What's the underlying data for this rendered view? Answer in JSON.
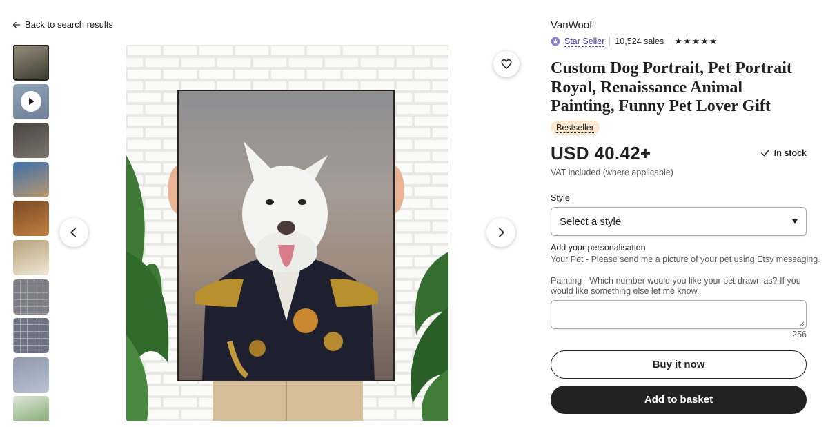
{
  "nav": {
    "back_label": "Back to search results"
  },
  "gallery": {
    "thumbnails": [
      {
        "kind": "portrait",
        "colors": [
          "#9a8f80",
          "#3a3a2e"
        ]
      },
      {
        "kind": "video",
        "colors": [
          "#8ea2b8",
          "#6d7f96"
        ]
      },
      {
        "kind": "photo",
        "colors": [
          "#4a4440",
          "#7b746c"
        ]
      },
      {
        "kind": "photo",
        "colors": [
          "#3f6fa8",
          "#b89870"
        ]
      },
      {
        "kind": "photo",
        "colors": [
          "#7a4a26",
          "#c08040"
        ]
      },
      {
        "kind": "photo",
        "colors": [
          "#b7a27a",
          "#efe7d6"
        ]
      },
      {
        "kind": "grid",
        "colors": [
          "#7e7e86",
          "#a4a0a6"
        ]
      },
      {
        "kind": "grid",
        "colors": [
          "#6e7382",
          "#a3a7b4"
        ]
      },
      {
        "kind": "photo",
        "colors": [
          "#8f99ad",
          "#b9c1d1"
        ]
      },
      {
        "kind": "photo",
        "colors": [
          "#dfe6d9",
          "#6fa05e"
        ]
      }
    ],
    "main_image": {
      "subject": "dog-portrait-royal"
    }
  },
  "product": {
    "shop_name": "VanWoof",
    "star_seller_label": "Star Seller",
    "sales": "10,524 sales",
    "rating_stars": "★★★★★",
    "title": "Custom Dog Portrait, Pet Portrait Royal, Renaissance Animal Painting, Funny Pet Lover Gift",
    "badge": "Bestseller",
    "price": "USD 40.42+",
    "stock": "In stock",
    "vat_note": "VAT included (where applicable)"
  },
  "options": {
    "style_label": "Style",
    "style_selected": "Select a style"
  },
  "personalisation": {
    "title": "Add your personalisation",
    "line1": "Your Pet - Please send me a picture of your pet using Etsy messaging.",
    "line2": "Painting - Which number would you like your pet drawn as? If you would like something else let me know.",
    "value": "",
    "char_count": "256"
  },
  "actions": {
    "buy_now": "Buy it now",
    "add_to_basket": "Add to basket"
  },
  "colors": {
    "accent_purple": "#4d3bb0",
    "bestseller_bg": "#fde8cf",
    "primary_button": "#222222"
  }
}
